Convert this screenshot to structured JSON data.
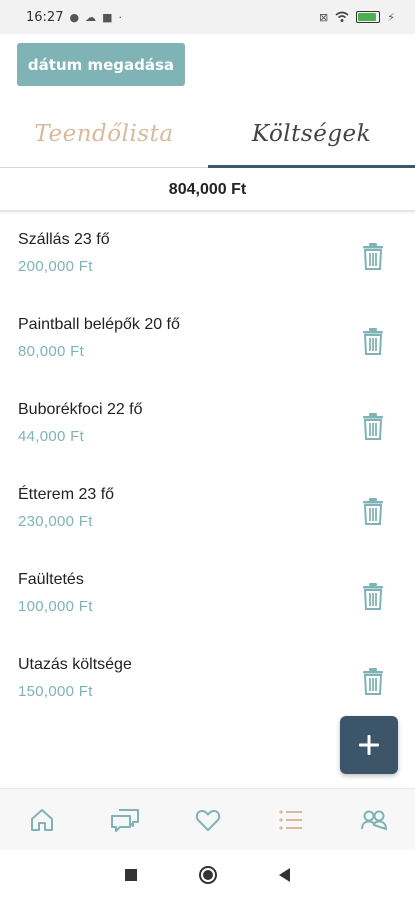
{
  "status_bar": {
    "time": "16:27",
    "battery_color": "#4caf50"
  },
  "header": {
    "date_button_label": "dátum megadása"
  },
  "tabs": [
    {
      "label": "Teendőlista",
      "active": false
    },
    {
      "label": "Költségek",
      "active": true
    }
  ],
  "total": "804,000 Ft",
  "expenses": [
    {
      "name": "Szállás 23 fő",
      "amount": "200,000 Ft"
    },
    {
      "name": "Paintball belépők 20 fő",
      "amount": "80,000 Ft"
    },
    {
      "name": "Buborékfoci 22 fő",
      "amount": "44,000 Ft"
    },
    {
      "name": "Étterem 23 fő",
      "amount": "230,000 Ft"
    },
    {
      "name": "Faültetés",
      "amount": "100,000 Ft"
    },
    {
      "name": "Utazás költsége",
      "amount": "150,000 Ft"
    }
  ],
  "fab": {
    "icon": "plus-icon"
  },
  "bottom_nav": [
    {
      "icon": "home-icon",
      "active": false
    },
    {
      "icon": "chat-icon",
      "active": false
    },
    {
      "icon": "heart-icon",
      "active": false
    },
    {
      "icon": "list-icon",
      "active": true
    },
    {
      "icon": "group-icon",
      "active": false
    }
  ],
  "colors": {
    "accent": "#7fb3b6",
    "dark": "#3d5568",
    "tab_inactive": "#d9b99b",
    "nav_active": "#d9b99b"
  }
}
